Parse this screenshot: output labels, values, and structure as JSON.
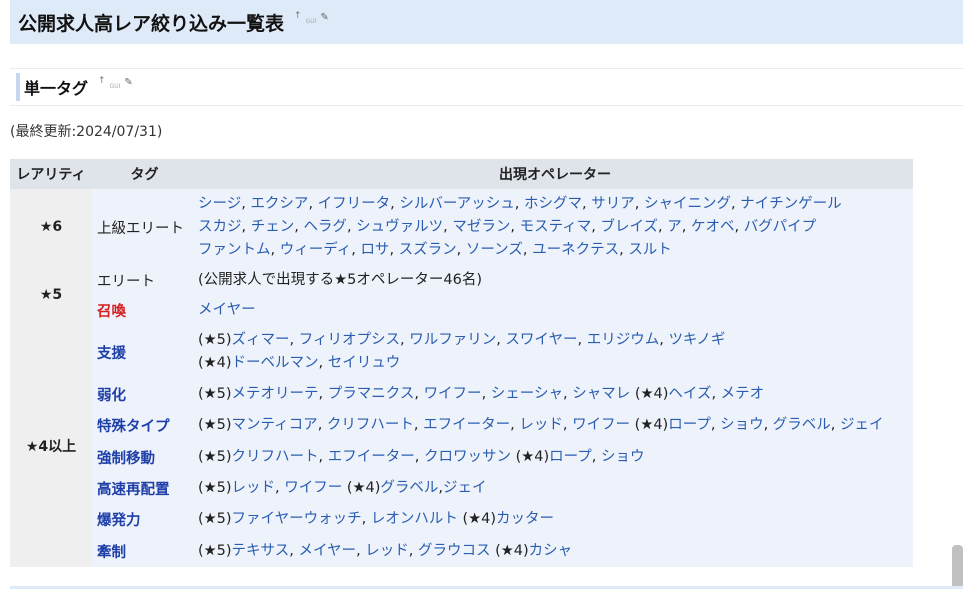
{
  "page_title": "公開求人高レア絞り込み一覧表",
  "section_title": "単一タグ",
  "edit_icons": {
    "up": "↑",
    "gui": "GUI",
    "pen": "✎"
  },
  "last_updated": "(最終更新:2024/07/31)",
  "table": {
    "headers": [
      "レアリティ",
      "タグ",
      "出現オペレーター"
    ],
    "rarity_labels": {
      "r6": "★6",
      "r5": "★5",
      "r4": "★4以上"
    },
    "rows": [
      {
        "tag": "上級エリート",
        "lines": [
          [
            "シージ",
            "エクシア",
            "イフリータ",
            "シルバーアッシュ",
            "ホシグマ",
            "サリア",
            "シャイニング",
            "ナイチンゲール"
          ],
          [
            "スカジ",
            "チェン",
            "ヘラグ",
            "シュヴァルツ",
            "マゼラン",
            "モスティマ",
            "ブレイズ",
            "ア",
            "ケオベ",
            "バグパイプ"
          ],
          [
            "ファントム",
            "ウィーディ",
            "ロサ",
            "スズラン",
            "ソーンズ",
            "ユーネクテス",
            "スルト"
          ]
        ]
      },
      {
        "tag": "エリート",
        "text": "(公開求人で出現する★5オペレーター46名)"
      },
      {
        "tag": "召喚",
        "names": [
          "メイヤー"
        ]
      },
      {
        "tag": "支援",
        "lines": [
          {
            "prefix": "(★5)",
            "names": [
              "ズィマー",
              "フィリオプシス",
              "ワルファリン",
              "スワイヤー",
              "エリジウム",
              "ツキノギ"
            ]
          },
          {
            "prefix": "(★4)",
            "names": [
              "ドーベルマン",
              "セイリュウ"
            ]
          }
        ]
      },
      {
        "tag": "弱化",
        "groups": [
          {
            "prefix": "(★5)",
            "names": [
              "メテオリーテ",
              "プラマニクス",
              "ワイフー",
              "シェーシャ",
              "シャマレ"
            ]
          },
          {
            "prefix": "(★4)",
            "names": [
              "ヘイズ",
              "メテオ"
            ]
          }
        ]
      },
      {
        "tag": "特殊タイプ",
        "groups": [
          {
            "prefix": "(★5)",
            "names": [
              "マンティコア",
              "クリフハート",
              "エフイーター",
              "レッド",
              "ワイフー"
            ]
          },
          {
            "prefix": "(★4)",
            "names": [
              "ロープ",
              "ショウ",
              "グラベル",
              "ジェイ"
            ]
          }
        ]
      },
      {
        "tag": "強制移動",
        "groups": [
          {
            "prefix": "(★5)",
            "names": [
              "クリフハート",
              "エフイーター",
              "クロワッサン"
            ]
          },
          {
            "prefix": "(★4)",
            "names": [
              "ロープ",
              "ショウ"
            ]
          }
        ]
      },
      {
        "tag": "高速再配置",
        "groups": [
          {
            "prefix": "(★5)",
            "names": [
              "レッド",
              "ワイフー"
            ]
          },
          {
            "prefix": "(★4)",
            "names": [
              "グラベル",
              "ジェイ"
            ],
            "sep": ","
          }
        ]
      },
      {
        "tag": "爆発力",
        "groups": [
          {
            "prefix": "(★5)",
            "names": [
              "ファイヤーウォッチ",
              "レオンハルト"
            ]
          },
          {
            "prefix": "(★4)",
            "names": [
              "カッター"
            ]
          }
        ]
      },
      {
        "tag": "牽制",
        "groups": [
          {
            "prefix": "(★5)",
            "names": [
              "テキサス",
              "メイヤー",
              "レッド",
              "グラウコス"
            ]
          },
          {
            "prefix": "(★4)",
            "names": [
              "カシャ"
            ]
          }
        ]
      }
    ]
  },
  "colors": {
    "link": "#2a5db0",
    "tag_red": "#d42020",
    "tag_blue": "#1f3fa8",
    "header_bg": "#dfeaf8"
  }
}
